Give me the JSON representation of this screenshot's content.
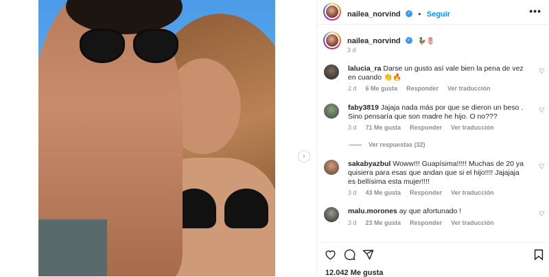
{
  "post": {
    "author": "nailea_norvind",
    "follow_label": "Seguir",
    "more_label": "•••",
    "caption_emojis": "🦆🌷",
    "caption_time": "3 d",
    "likes": "12.042 Me gusta",
    "next_label": "›"
  },
  "comments": [
    {
      "user": "lalucia_ra",
      "text": "Darse un gusto así vale bien la pena de vez en cuando 👏🔥",
      "time": "2 d",
      "likes": "6 Me gusta",
      "reply": "Responder",
      "translate": "Ver traducción"
    },
    {
      "user": "faby3819",
      "text": "Jajaja nada más por que se dieron un beso . Sino pensaría que son madre he hijo. O no???",
      "time": "3 d",
      "likes": "71 Me gusta",
      "reply": "Responder",
      "translate": "Ver traducción",
      "replies_label": "Ver respuestas (32)"
    },
    {
      "user": "sakabyazbul",
      "text": "Woww!!! Guapísima!!!!! Muchas de 20 ya quisiera para esas que andan que si el hijo!!!! Jajajaja es bellísima esta mujer!!!!",
      "time": "3 d",
      "likes": "43 Me gusta",
      "reply": "Responder",
      "translate": "Ver traducción"
    },
    {
      "user": "malu.morones",
      "text": "ay que afortunado !",
      "time": "3 d",
      "likes": "23 Me gusta",
      "reply": "Responder",
      "translate": "Ver traducción"
    }
  ],
  "icons": {
    "heart": "heart-icon",
    "comment": "comment-icon",
    "share": "share-icon",
    "save": "bookmark-icon"
  },
  "colors": {
    "accent": "#0095f6",
    "verified": "#3897f0",
    "muted": "#8e8e8e"
  }
}
